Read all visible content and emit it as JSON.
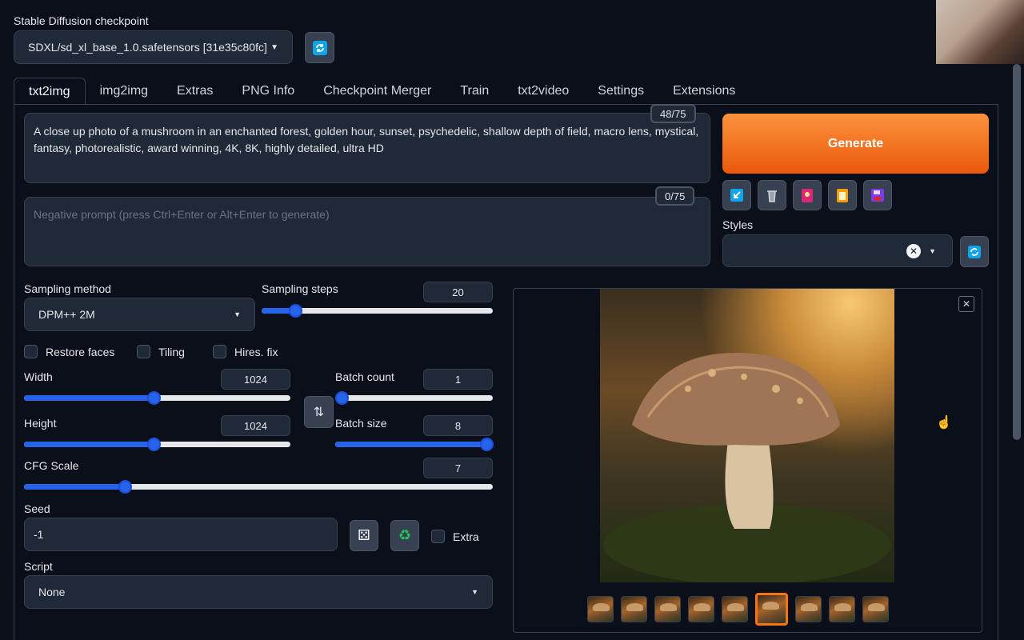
{
  "checkpoint": {
    "label": "Stable Diffusion checkpoint",
    "value": "SDXL/sd_xl_base_1.0.safetensors [31e35c80fc]"
  },
  "tabs": [
    "txt2img",
    "img2img",
    "Extras",
    "PNG Info",
    "Checkpoint Merger",
    "Train",
    "txt2video",
    "Settings",
    "Extensions"
  ],
  "prompt": {
    "text": "A close up photo of a mushroom in an enchanted forest, golden hour, sunset, psychedelic, shallow depth of field, macro lens, mystical, fantasy, photorealistic, award winning, 4K, 8K, highly detailed, ultra HD",
    "counter": "48/75"
  },
  "negative_prompt": {
    "placeholder": "Negative prompt (press Ctrl+Enter or Alt+Enter to generate)",
    "counter": "0/75"
  },
  "generate_label": "Generate",
  "styles_label": "Styles",
  "sampling": {
    "method_label": "Sampling method",
    "method_value": "DPM++ 2M",
    "steps_label": "Sampling steps",
    "steps_value": "20"
  },
  "checkboxes": {
    "restore_faces": "Restore faces",
    "tiling": "Tiling",
    "hires_fix": "Hires. fix"
  },
  "width": {
    "label": "Width",
    "value": "1024"
  },
  "height": {
    "label": "Height",
    "value": "1024"
  },
  "batch_count": {
    "label": "Batch count",
    "value": "1"
  },
  "batch_size": {
    "label": "Batch size",
    "value": "8"
  },
  "cfg_scale": {
    "label": "CFG Scale",
    "value": "7"
  },
  "seed": {
    "label": "Seed",
    "value": "-1",
    "extra_label": "Extra"
  },
  "script": {
    "label": "Script",
    "value": "None"
  },
  "gallery": {
    "thumbnail_count": 9,
    "selected_index": 5
  },
  "colors": {
    "background": "#0b0f19",
    "accent_orange": "#f97316",
    "slider_blue": "#2563eb"
  }
}
